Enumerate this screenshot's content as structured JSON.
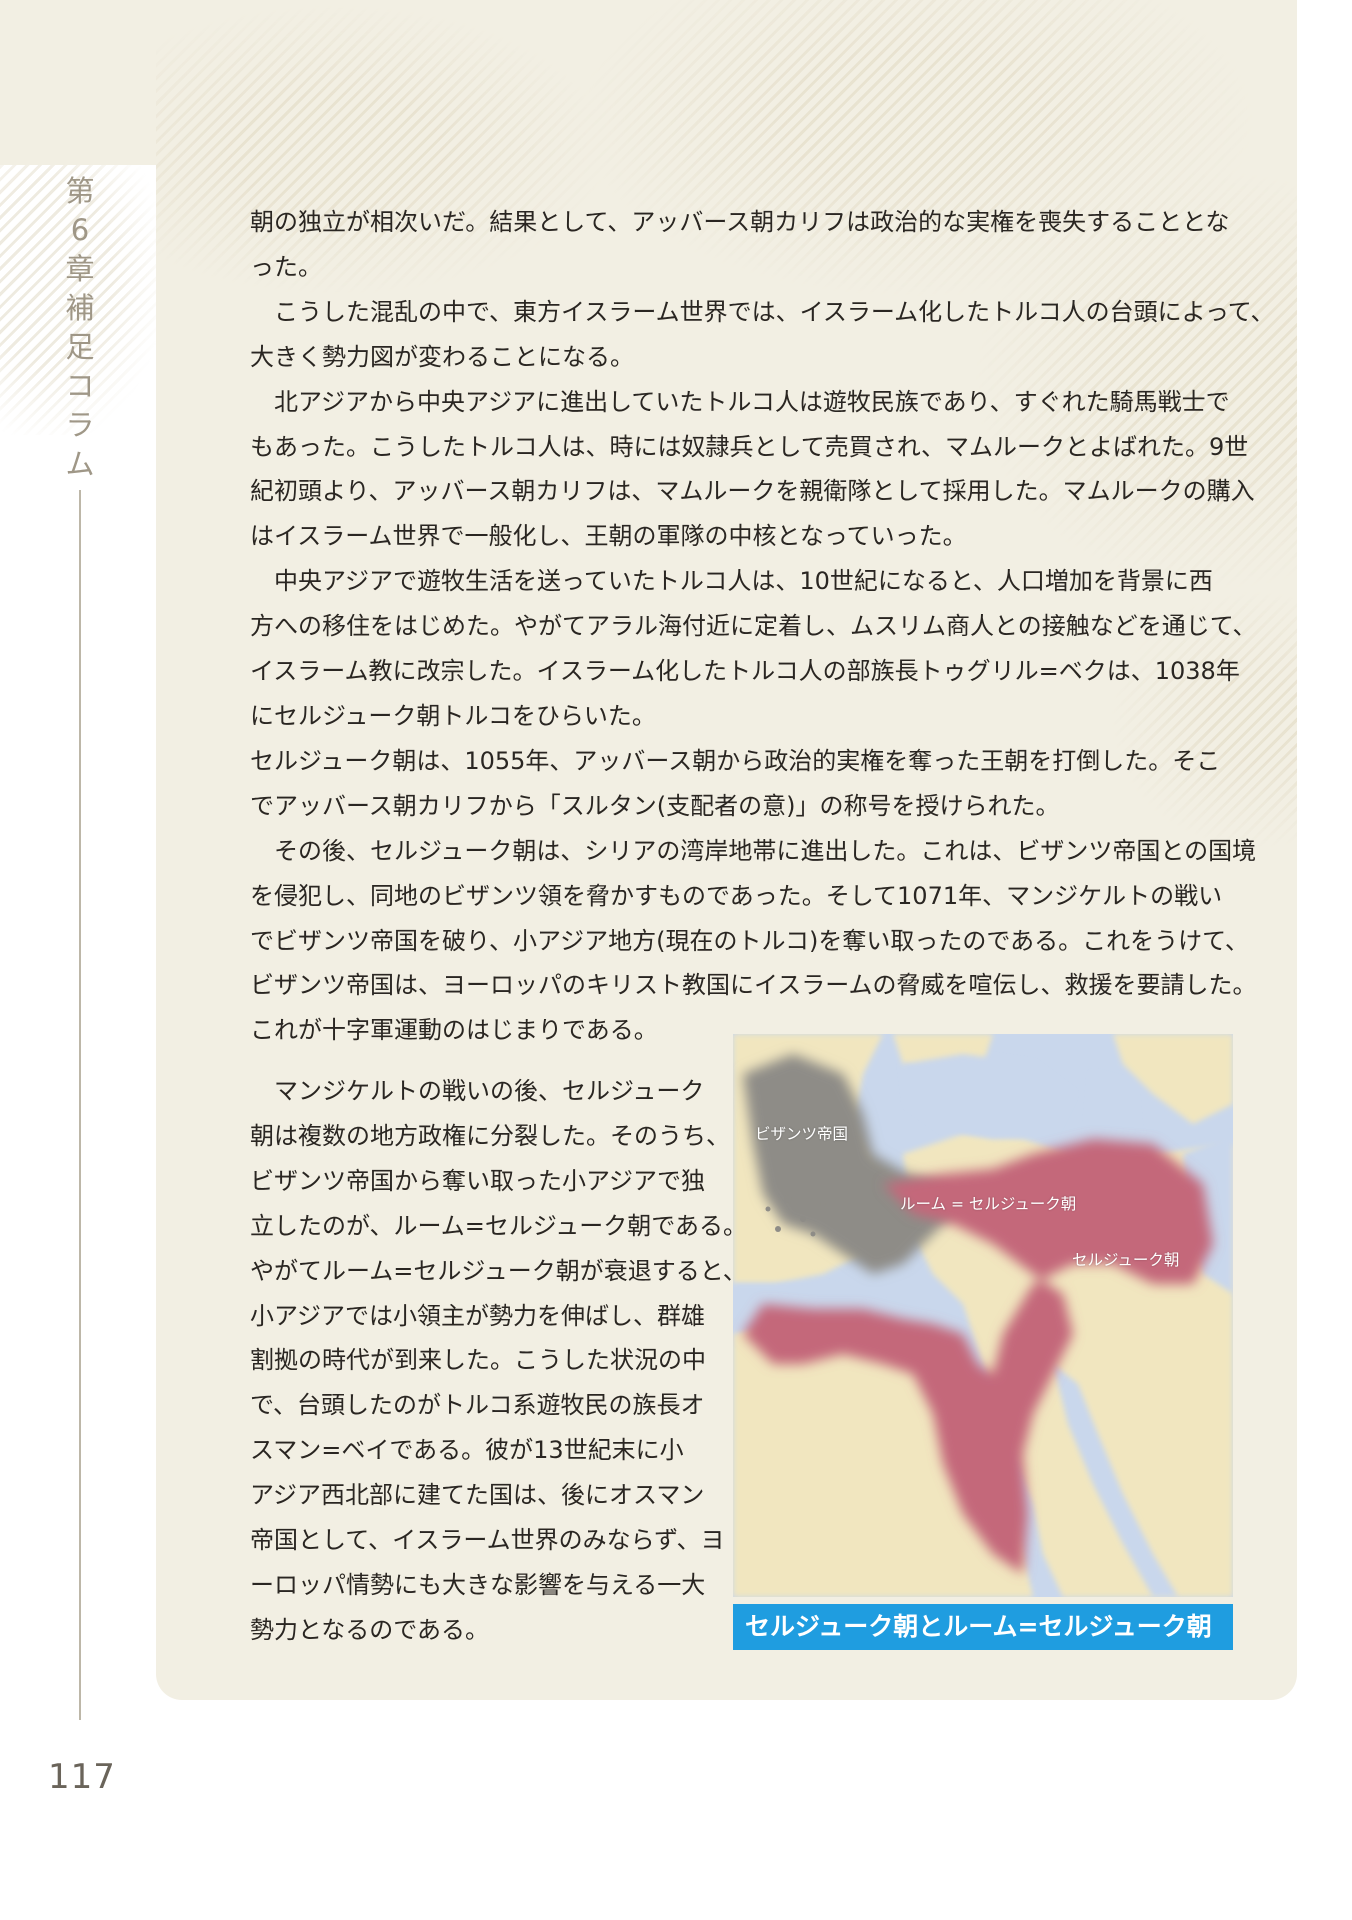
{
  "sidebar": {
    "chapter_chars": [
      "第",
      "6",
      "章",
      "補",
      "足",
      "コ",
      "ラ",
      "ム"
    ],
    "page_number": "117"
  },
  "body": {
    "lines": [
      {
        "text": "朝の独立が相次いだ。結果として、アッバース朝カリフは政治的な実権を喪失することとな",
        "indent": false
      },
      {
        "text": "った。",
        "indent": false
      },
      {
        "text": "こうした混乱の中で、東方イスラーム世界では、イスラーム化したトルコ人の台頭によって、",
        "indent": true
      },
      {
        "text": "大きく勢力図が変わることになる。",
        "indent": false
      },
      {
        "text": "北アジアから中央アジアに進出していたトルコ人は遊牧民族であり、すぐれた騎馬戦士で",
        "indent": true
      },
      {
        "text": "もあった。こうしたトルコ人は、時には奴隷兵として売買され、マムルークとよばれた。9世",
        "indent": false
      },
      {
        "text": "紀初頭より、アッバース朝カリフは、マムルークを親衛隊として採用した。マムルークの購入",
        "indent": false
      },
      {
        "text": "はイスラーム世界で一般化し、王朝の軍隊の中核となっていった。",
        "indent": false
      },
      {
        "text": "中央アジアで遊牧生活を送っていたトルコ人は、10世紀になると、人口増加を背景に西",
        "indent": true
      },
      {
        "text": "方への移住をはじめた。やがてアラル海付近に定着し、ムスリム商人との接触などを通じて、",
        "indent": false
      },
      {
        "text": "イスラーム教に改宗した。イスラーム化したトルコ人の部族長トゥグリル=ベクは、1038年",
        "indent": false
      },
      {
        "text": "にセルジューク朝トルコをひらいた。",
        "indent": false
      },
      {
        "text": "セルジューク朝は、1055年、アッバース朝から政治的実権を奪った王朝を打倒した。そこ",
        "indent": false
      },
      {
        "text": "でアッバース朝カリフから「スルタン(支配者の意)」の称号を授けられた。",
        "indent": false
      },
      {
        "text": "その後、セルジューク朝は、シリアの湾岸地帯に進出した。これは、ビザンツ帝国との国境",
        "indent": true
      },
      {
        "text": "を侵犯し、同地のビザンツ領を脅かすものであった。そして1071年、マンジケルトの戦い",
        "indent": false
      },
      {
        "text": "でビザンツ帝国を破り、小アジア地方(現在のトルコ)を奪い取ったのである。これをうけて、",
        "indent": false
      },
      {
        "text": "ビザンツ帝国は、ヨーロッパのキリスト教国にイスラームの脅威を喧伝し、救援を要請した。",
        "indent": false
      },
      {
        "text": "これが十字軍運動のはじまりである。",
        "indent": false
      }
    ],
    "narrow_lines": [
      {
        "text": "マンジケルトの戦いの後、セルジューク",
        "indent": true
      },
      {
        "text": "朝は複数の地方政権に分裂した。そのうち、",
        "indent": false
      },
      {
        "text": "ビザンツ帝国から奪い取った小アジアで独",
        "indent": false
      },
      {
        "text": "立したのが、ルーム=セルジューク朝である。",
        "indent": false
      },
      {
        "text": "やがてルーム=セルジューク朝が衰退すると、",
        "indent": false
      },
      {
        "text": "小アジアでは小領主が勢力を伸ばし、群雄",
        "indent": false
      },
      {
        "text": "割拠の時代が到来した。こうした状況の中",
        "indent": false
      },
      {
        "text": "で、台頭したのがトルコ系遊牧民の族長オ",
        "indent": false
      },
      {
        "text": "スマン=ベイである。彼が13世紀末に小",
        "indent": false
      },
      {
        "text": "アジア西北部に建てた国は、後にオスマン",
        "indent": false
      },
      {
        "text": "帝国として、イスラーム世界のみならず、ヨ",
        "indent": false
      },
      {
        "text": "ーロッパ情勢にも大きな影響を与える一大",
        "indent": false
      },
      {
        "text": "勢力となるのである。",
        "indent": false
      }
    ]
  },
  "map": {
    "labels": {
      "byzantine": "ビザンツ帝国",
      "rum": "ルーム = セルジューク朝",
      "seljuk": "セルジューク朝"
    },
    "caption": "セルジューク朝とルーム=セルジューク朝",
    "colors": {
      "sea": "#c9d7ec",
      "land": "#f1e6bf",
      "byzantine": "#8e8c87",
      "seljuk": "#c4687a",
      "caption_bg": "#1f9de0"
    }
  }
}
